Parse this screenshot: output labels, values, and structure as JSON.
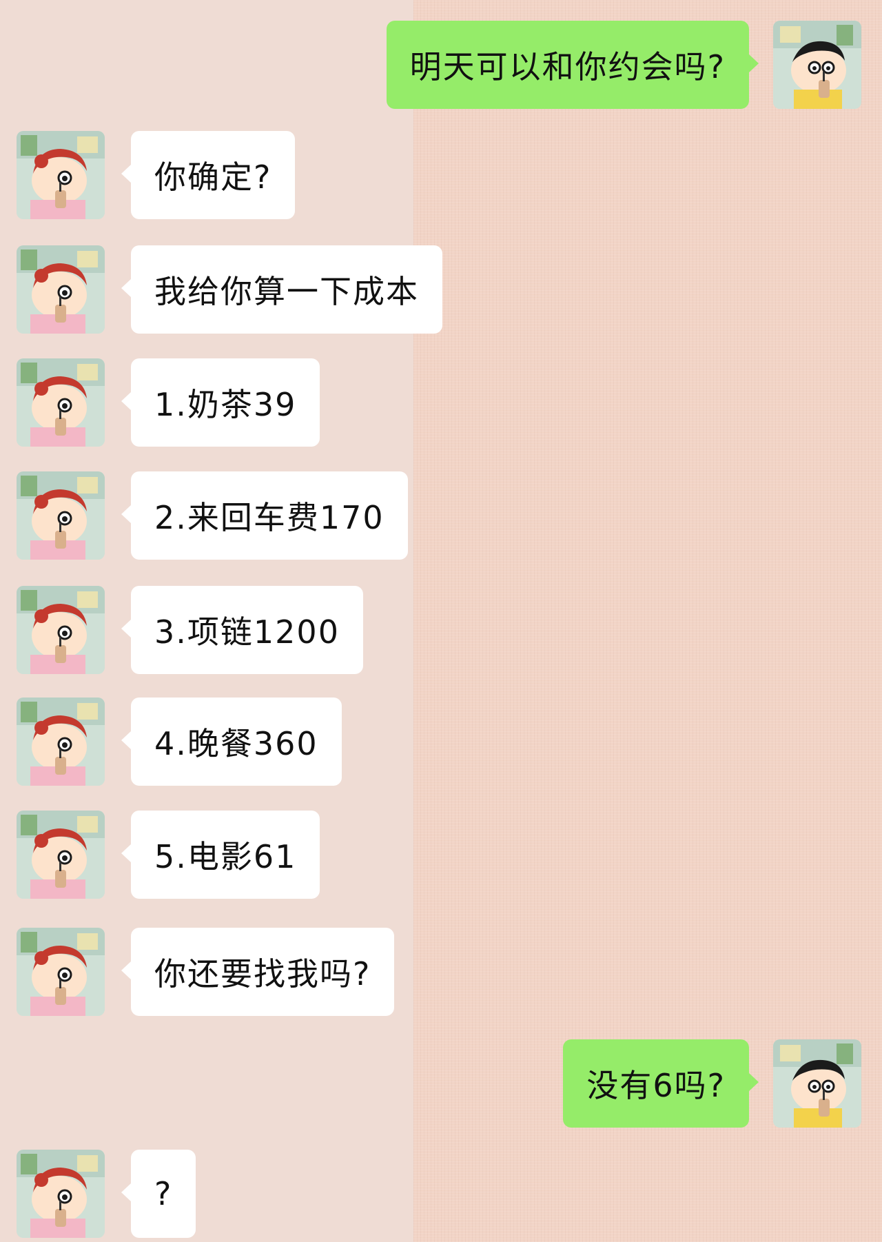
{
  "colors": {
    "background": "#f2d4c6",
    "incoming_bubble": "#ffffff",
    "outgoing_bubble": "#95ec69",
    "text": "#111111"
  },
  "avatars": {
    "self": "boy-cartoon-avatar-icon",
    "contact": "girl-cartoon-avatar-icon"
  },
  "messages": [
    {
      "from": "self",
      "text": "明天可以和你约会吗?"
    },
    {
      "from": "contact",
      "text": "你确定?"
    },
    {
      "from": "contact",
      "text": "我给你算一下成本"
    },
    {
      "from": "contact",
      "text": "1.奶茶39"
    },
    {
      "from": "contact",
      "text": "2.来回车费170"
    },
    {
      "from": "contact",
      "text": "3.项链1200"
    },
    {
      "from": "contact",
      "text": "4.晚餐360"
    },
    {
      "from": "contact",
      "text": "5.电影61"
    },
    {
      "from": "contact",
      "text": "你还要找我吗?"
    },
    {
      "from": "self",
      "text": "没有6吗?"
    },
    {
      "from": "contact",
      "text": "?"
    }
  ]
}
